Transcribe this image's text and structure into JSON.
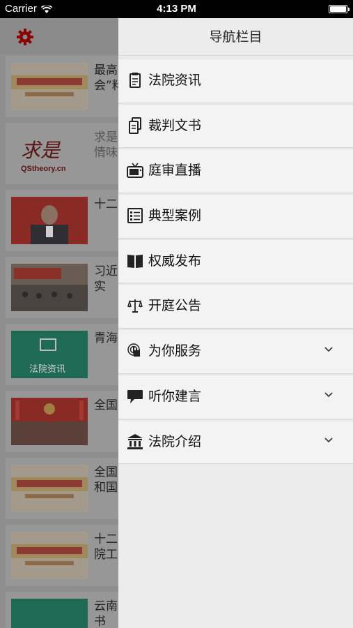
{
  "status": {
    "carrier": "Carrier",
    "time": "4:13 PM"
  },
  "drawer": {
    "title": "导航栏目",
    "items": [
      {
        "label": "法院资讯",
        "icon": "document-icon",
        "has_chevron": false
      },
      {
        "label": "裁判文书",
        "icon": "papers-icon",
        "has_chevron": false
      },
      {
        "label": "庭审直播",
        "icon": "tv-icon",
        "has_chevron": false
      },
      {
        "label": "典型案例",
        "icon": "list-icon",
        "has_chevron": false
      },
      {
        "label": "权威发布",
        "icon": "book-icon",
        "has_chevron": false
      },
      {
        "label": "开庭公告",
        "icon": "scales-icon",
        "has_chevron": false
      },
      {
        "label": "为你服务",
        "icon": "service-hand-icon",
        "has_chevron": true
      },
      {
        "label": "听你建言",
        "icon": "speech-bubble-icon",
        "has_chevron": true
      },
      {
        "label": "法院介绍",
        "icon": "courthouse-icon",
        "has_chevron": true
      }
    ]
  },
  "background_list": {
    "items": [
      {
        "title": "最高\n会”料",
        "thumb": "banner"
      },
      {
        "title": "求是\n情味",
        "thumb": "qstheory",
        "thumb_text": "QStheory.cn",
        "thumb_logo": "求是"
      },
      {
        "title": "十二",
        "thumb": "red-portrait"
      },
      {
        "title": "习近\n实",
        "thumb": "meeting"
      },
      {
        "title": "青海",
        "thumb": "green",
        "thumb_text": "法院资讯"
      },
      {
        "title": "全国",
        "thumb": "hall"
      },
      {
        "title": "全国\n和国",
        "thumb": "banner"
      },
      {
        "title": "十二\n院工",
        "thumb": "banner"
      },
      {
        "title": "云南\n书",
        "thumb": "green"
      }
    ]
  },
  "colors": {
    "accent": "#8a0000",
    "drawer_bg": "#ececec",
    "dim_overlay": "#8e8e8e"
  }
}
